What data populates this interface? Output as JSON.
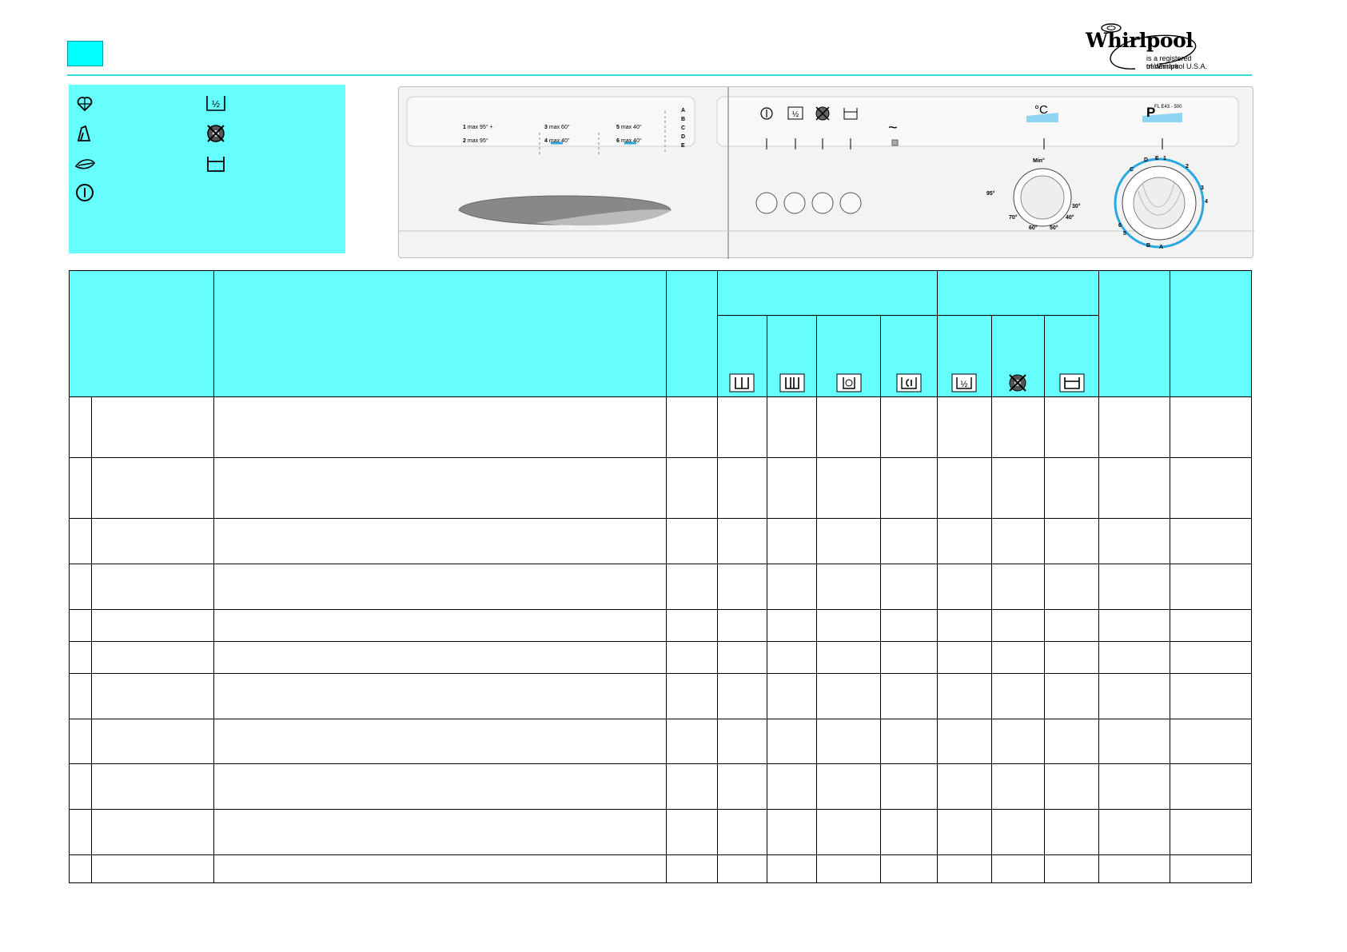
{
  "brand": {
    "name": "Whirlpool",
    "tagline_line1": "is a registered trademark",
    "tagline_line2": "of Whirlpool U.S.A."
  },
  "panel": {
    "model": "FL E43 - 500",
    "prog_group1": {
      "row1": {
        "num": "1",
        "max_label": "max",
        "temp": "95°",
        "plus": "+"
      },
      "row2": {
        "num": "2",
        "max_label": "max",
        "temp": "95°"
      }
    },
    "prog_group2": {
      "row1": {
        "num": "3",
        "max_label": "max",
        "temp": "60°"
      },
      "row2": {
        "num": "4",
        "max_label": "max",
        "temp": "40°"
      }
    },
    "prog_group3": {
      "row1": {
        "num": "5",
        "max_label": "max",
        "temp": "40°"
      },
      "row2": {
        "num": "6",
        "max_label": "max",
        "temp": "40°"
      }
    },
    "special_letters": [
      "A",
      "B",
      "C",
      "D",
      "E"
    ],
    "tilde": "~",
    "temp_symbol": "°C",
    "prog_symbol": "P",
    "temp_dial": {
      "min_label": "Min°",
      "t95": "95°",
      "t70": "70°",
      "t60": "60°",
      "t50": "50°",
      "t40": "40°",
      "t30": "30°"
    },
    "prog_dial": {
      "labels": [
        "D",
        "E",
        "1",
        "2",
        "3",
        "4",
        "C",
        "6",
        "5",
        "B",
        "A"
      ]
    }
  },
  "icons": {
    "cotton": "cotton-icon",
    "synthetic": "synthetic-icon",
    "wool": "wool-icon",
    "power": "power-icon",
    "half_load": "half-load-icon",
    "no_spin": "no-spin-icon",
    "rinse_hold": "rinse-hold-icon",
    "prewash": "prewash-icon",
    "main_wash": "main-wash-icon",
    "softener": "softener-icon",
    "bleach": "bleach-icon"
  },
  "colors": {
    "cyan_fill": "#66ffff",
    "header_square": "#00ffff",
    "rule": "#33dddd",
    "panel_bg": "#f3f3f3",
    "accent_blue": "#2ba7e2"
  }
}
